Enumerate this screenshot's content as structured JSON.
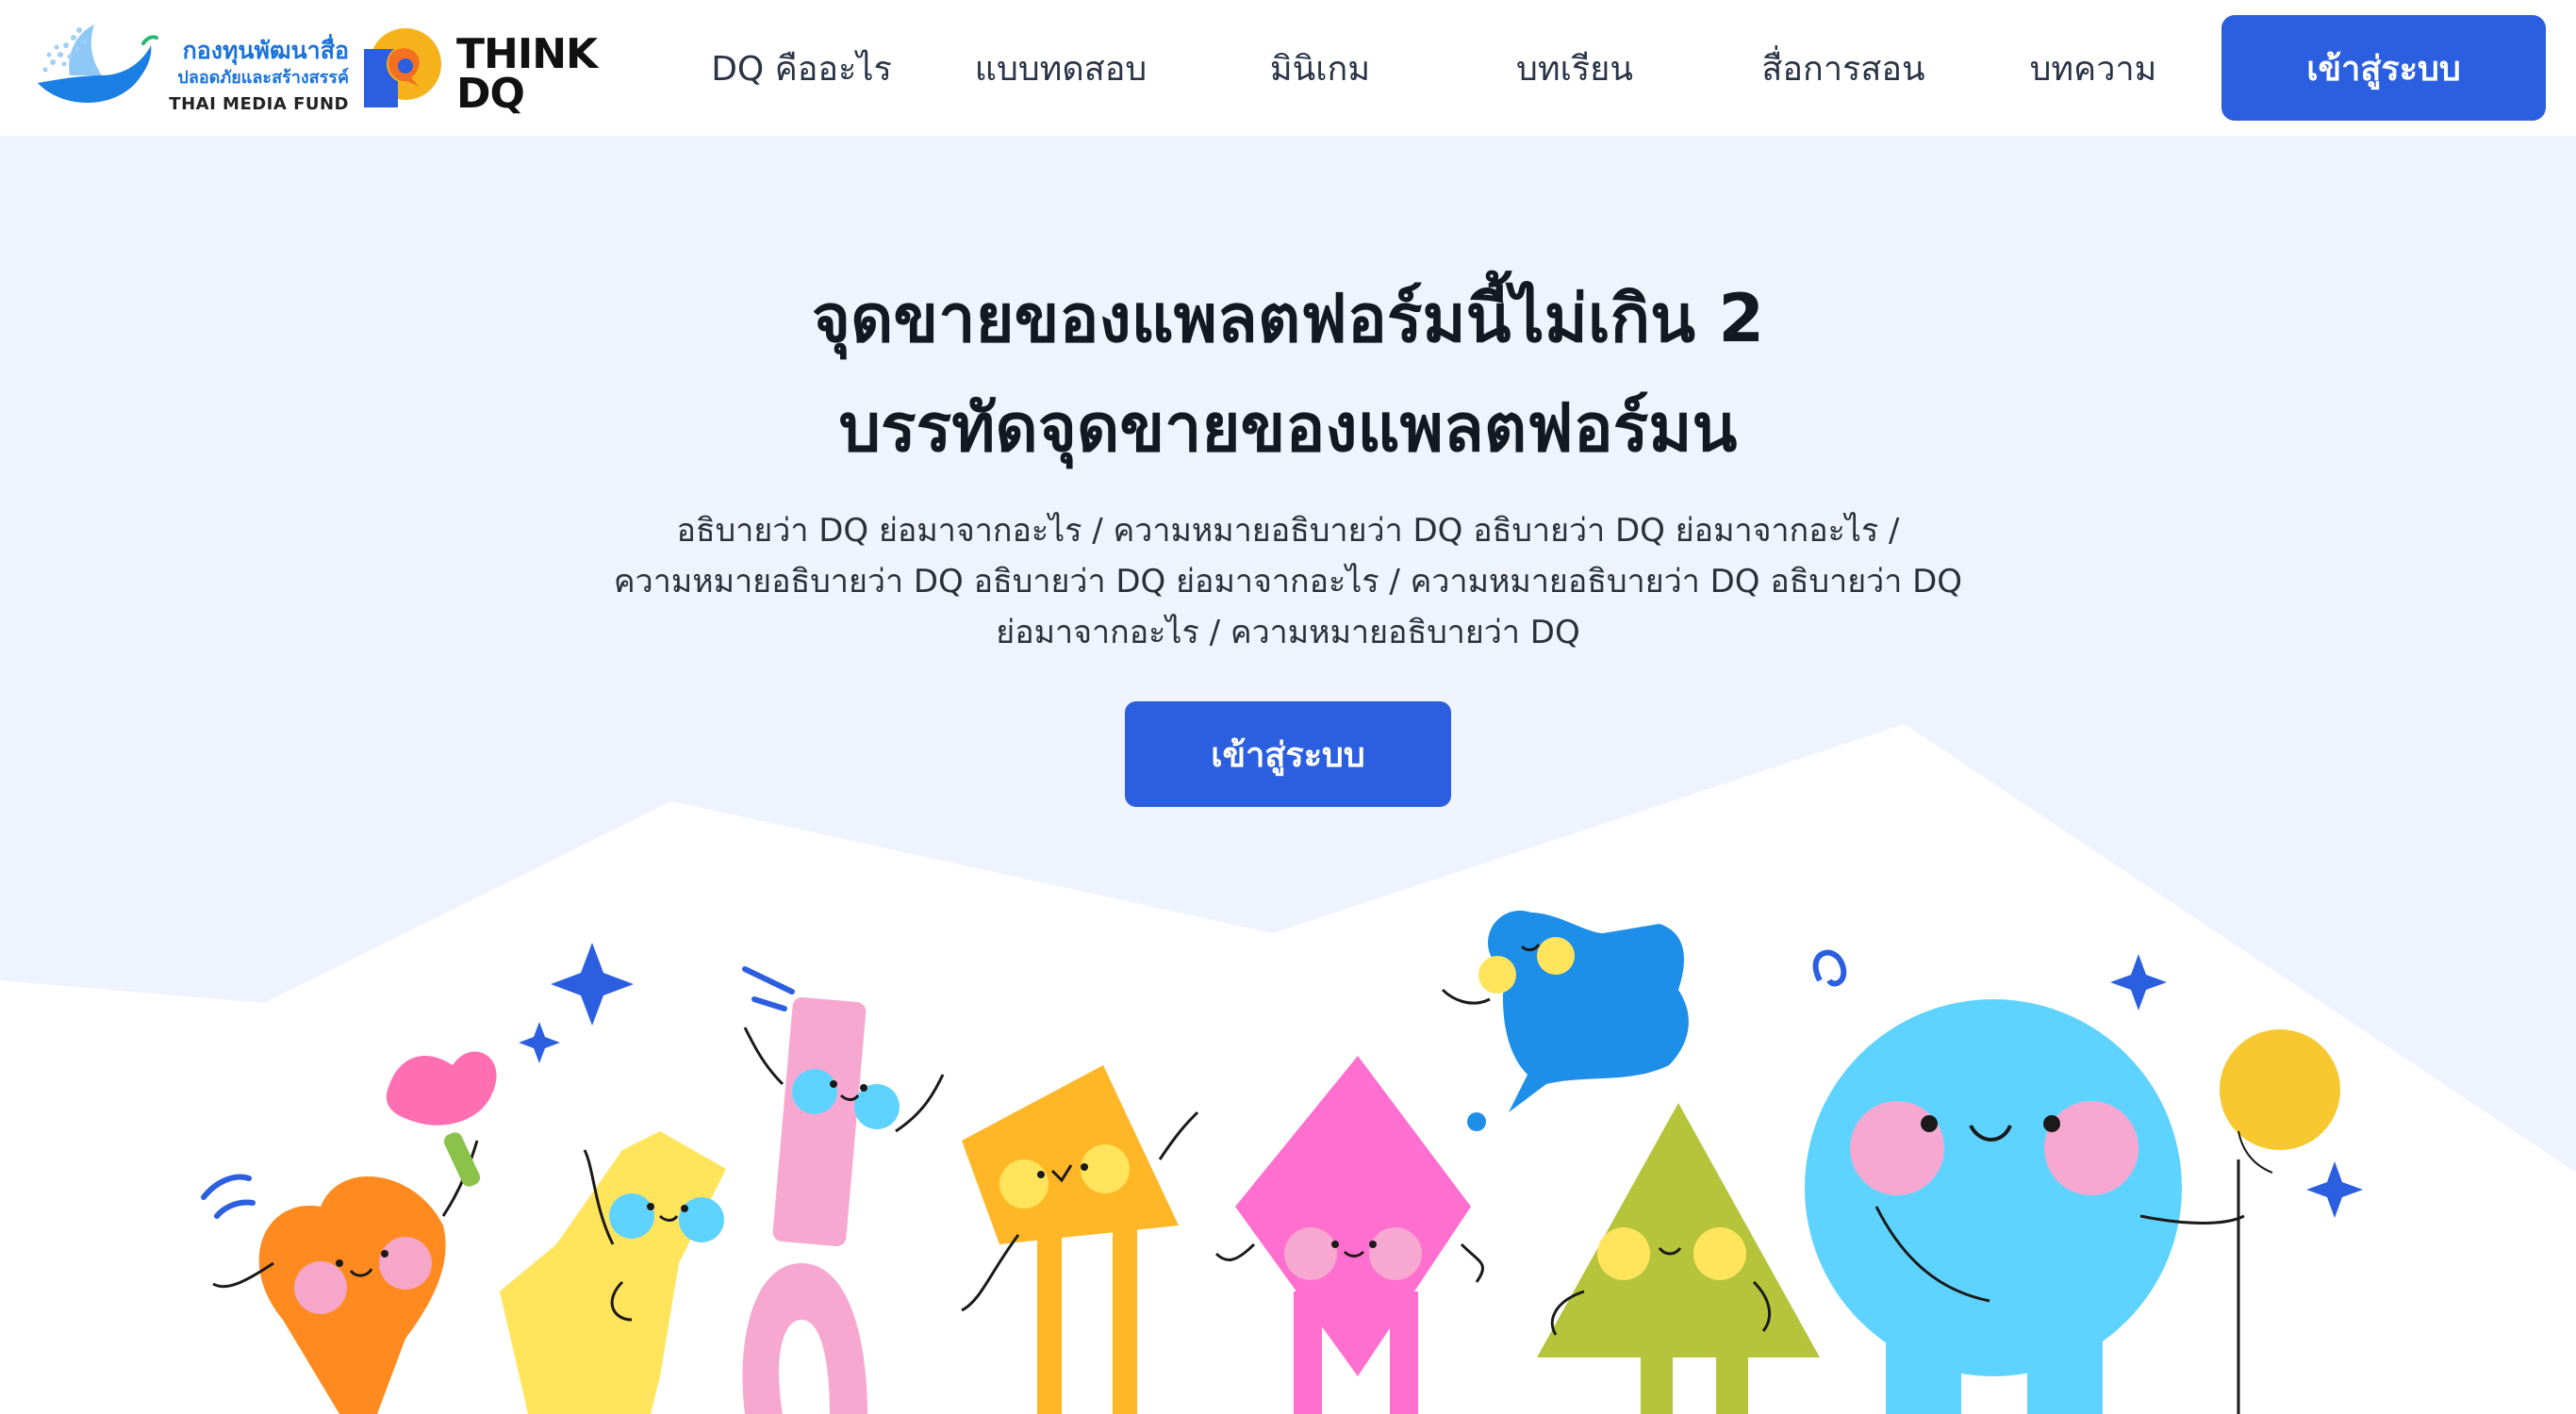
{
  "brand": {
    "fund_name_th": "กองทุนพัฒนาสื่อ",
    "fund_sub_th": "ปลอดภัยและสร้างสรรค์",
    "fund_name_en": "THAI MEDIA FUND",
    "product_line1": "THINK",
    "product_line2": "DQ"
  },
  "nav": {
    "items": [
      {
        "label": "DQ คืออะไร"
      },
      {
        "label": "แบบทดสอบ"
      },
      {
        "label": "มินิเกม"
      },
      {
        "label": "บทเรียน"
      },
      {
        "label": "สื่อการสอน"
      },
      {
        "label": "บทความ"
      }
    ],
    "login_label": "เข้าสู่ระบบ"
  },
  "hero": {
    "headline_line1": "จุดขายของแพลตฟอร์มนี้ไม่เกิน 2",
    "headline_line2": "บรรทัดจุดขายของแพลตฟอร์มน",
    "description_line1": "อธิบายว่า DQ ย่อมาจากอะไร / ความหมายอธิบายว่า DQ อธิบายว่า DQ ย่อมาจากอะไร /",
    "description_line2": "ความหมายอธิบายว่า DQ อธิบายว่า DQ ย่อมาจากอะไร / ความหมายอธิบายว่า DQ อธิบายว่า DQ",
    "description_line3": "ย่อมาจากอะไร / ความหมายอธิบายว่า DQ",
    "cta_label": "เข้าสู่ระบบ"
  },
  "colors": {
    "primary": "#2b5fe0",
    "hero_bg": "#eef3fd",
    "brand_blue": "#1b73d8"
  },
  "icons": {
    "fund_logo": "dove-logo-icon",
    "think_logo": "think-dq-logo-icon",
    "illustration": "dancing-shapes-illustration"
  }
}
